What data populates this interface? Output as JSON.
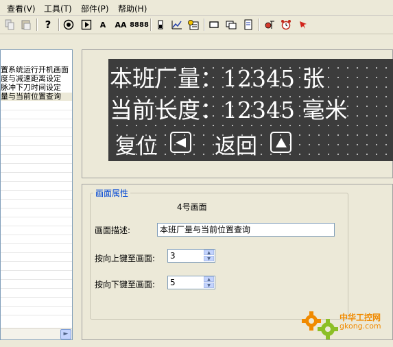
{
  "menu": {
    "items": [
      {
        "label": "查看(V)"
      },
      {
        "label": "工具(T)"
      },
      {
        "label": "部件(P)"
      },
      {
        "label": "帮助(H)"
      }
    ]
  },
  "toolbar": {
    "text_a": "A",
    "text_aa": "AA",
    "text_num": "8888"
  },
  "tree": {
    "items": [
      {
        "label": "置系统运行开机画面"
      },
      {
        "label": "度与减速距离设定"
      },
      {
        "label": "脉冲下刀时间设定"
      },
      {
        "label": "量与当前位置查询"
      }
    ]
  },
  "screen": {
    "line1": "本班厂量：12345 张",
    "line2": "当前长度：12345 毫米",
    "reset_label": "复位",
    "return_label": "返回"
  },
  "props": {
    "group_title": "画面属性",
    "screen_name": "4号画面",
    "desc_label": "画面描述:",
    "desc_value": "本班厂量与当前位置查询",
    "up_label": "按向上键至画面:",
    "up_value": "3",
    "down_label": "按向下键至画面:",
    "down_value": "5"
  },
  "watermark": {
    "title": "中华工控网",
    "url": "gkong.com"
  },
  "colors": {
    "screen_bg": "#3c3c3c",
    "group_title": "#0046d5",
    "watermark_orange": "#f08a00"
  }
}
